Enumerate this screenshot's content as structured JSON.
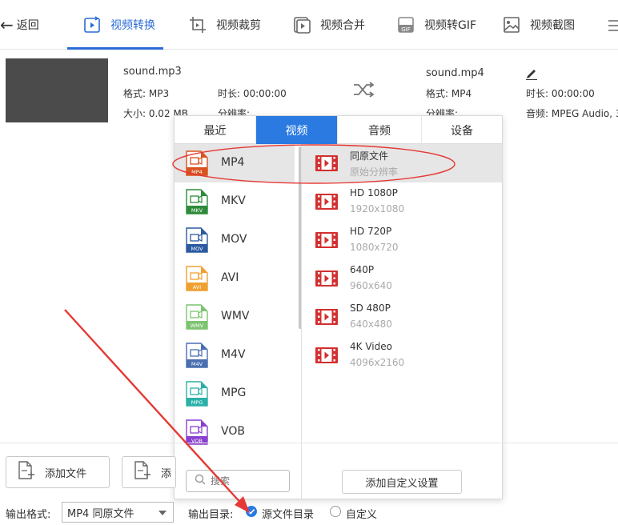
{
  "nav": {
    "back_label": "返回",
    "tabs": [
      {
        "label": "视频转换",
        "icon": "video-convert-icon",
        "active": true
      },
      {
        "label": "视频裁剪",
        "icon": "video-crop-icon",
        "active": false
      },
      {
        "label": "视频合并",
        "icon": "video-merge-icon",
        "active": false
      },
      {
        "label": "视频转GIF",
        "icon": "gif-icon",
        "active": false
      },
      {
        "label": "视频截图",
        "icon": "screenshot-icon",
        "active": false
      }
    ]
  },
  "source_file": {
    "name": "sound.mp3",
    "format": "格式: MP3",
    "duration": "时长: 00:00:00",
    "size": "大小: 0.02 MB",
    "resolution": "分辨率:"
  },
  "output_file": {
    "name": "sound.mp4",
    "format": "格式: MP4",
    "duration": "时长: 00:00:00",
    "resolution": "分辨率:",
    "audio": "音频: MPEG Audio, 3"
  },
  "popup": {
    "tabs": [
      "最近",
      "视频",
      "音频",
      "设备"
    ],
    "active_tab": "视频",
    "formats": [
      {
        "label": "MP4",
        "badge": "MP4",
        "color": "#d9531e"
      },
      {
        "label": "MKV",
        "badge": "MKV",
        "color": "#2e8b3a"
      },
      {
        "label": "MOV",
        "badge": "MOV",
        "color": "#2c5aa0"
      },
      {
        "label": "AVI",
        "badge": "AVI",
        "color": "#f0a030"
      },
      {
        "label": "WMV",
        "badge": "WMV",
        "color": "#7dc470"
      },
      {
        "label": "M4V",
        "badge": "M4V",
        "color": "#4a6fb0"
      },
      {
        "label": "MPG",
        "badge": "MPG",
        "color": "#2ab0a8"
      },
      {
        "label": "VOB",
        "badge": "VOB",
        "color": "#8a3fd0"
      }
    ],
    "selected_format": "MP4",
    "presets": [
      {
        "name": "同原文件",
        "sub": "原始分辨率"
      },
      {
        "name": "HD 1080P",
        "sub": "1920x1080"
      },
      {
        "name": "HD 720P",
        "sub": "1080x720"
      },
      {
        "name": "640P",
        "sub": "960x640"
      },
      {
        "name": "SD 480P",
        "sub": "640x480"
      },
      {
        "name": "4K Video",
        "sub": "4096x2160"
      }
    ],
    "search_placeholder": "搜索",
    "add_custom_label": "添加自定义设置"
  },
  "bottom": {
    "add_file_label": "添加文件",
    "add_folder_label": "添",
    "output_format_label": "输出格式:",
    "output_format_value": "MP4 同原文件",
    "output_dir_label": "输出目录:",
    "dir_option_source": "源文件目录",
    "dir_option_custom": "自定义",
    "dir_selected": "源文件目录"
  },
  "colors": {
    "accent": "#2a7ae2",
    "annotation_red": "#e53935",
    "preset_icon_red": "#d32f2f"
  }
}
